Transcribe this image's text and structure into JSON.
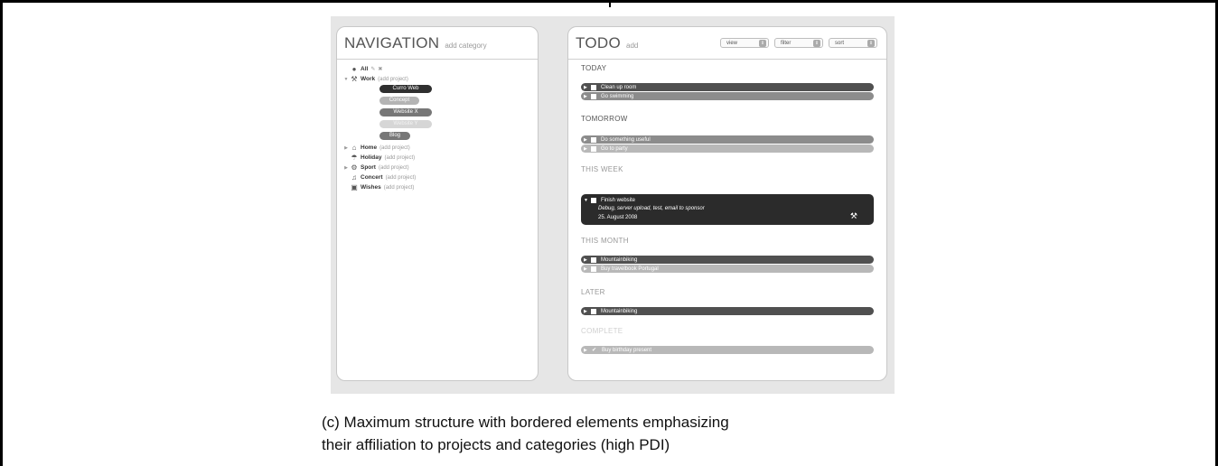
{
  "navigation": {
    "title": "NAVIGATION",
    "add_label": "add category",
    "all_label": "All",
    "categories": [
      {
        "label": "Work",
        "sub": "(add project)",
        "icon": "tools-icon"
      },
      {
        "label": "Home",
        "sub": "(add project)",
        "icon": "house-icon"
      },
      {
        "label": "Holiday",
        "sub": "(add project)",
        "icon": "umbrella-icon"
      },
      {
        "label": "Sport",
        "sub": "(add project)",
        "icon": "bicycle-icon"
      },
      {
        "label": "Concert",
        "sub": "(add project)",
        "icon": "headphones-icon"
      },
      {
        "label": "Wishes",
        "sub": "(add project)",
        "icon": "gift-icon"
      }
    ],
    "projects": [
      "Curro Web",
      "Concept",
      "Website X",
      "Website Y",
      "Blog"
    ]
  },
  "todo": {
    "title": "TODO",
    "add_label": "add",
    "controls": {
      "view": "view",
      "filter": "filter",
      "sort": "sort"
    },
    "sections": {
      "today": "TODAY",
      "tomorrow": "TOMORROW",
      "this_week": "THIS WEEK",
      "this_month": "THIS MONTH",
      "later": "LATER",
      "complete": "COMPLETE"
    },
    "tasks": {
      "today": [
        "Clean up room",
        "Go swimming"
      ],
      "tomorrow": [
        "Do something useful",
        "Go to party"
      ],
      "this_week": {
        "title": "Finish website",
        "description": "Debug, server upload, test, email to sponsor",
        "date": "25. August 2008"
      },
      "this_month": [
        "Mountainbiking",
        "Buy travelbook Portugal"
      ],
      "later": [
        "Mountainbiking"
      ],
      "complete": [
        "Buy birthday present"
      ]
    }
  },
  "caption": {
    "line1": "(c)  Maximum structure with bordered elements emphasizing",
    "line2": "their affiliation to projects and categories (high PDI)"
  }
}
